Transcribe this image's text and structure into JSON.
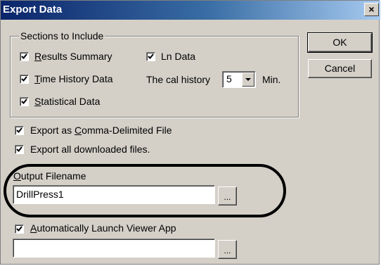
{
  "window": {
    "title": "Export Data",
    "close_glyph": "×"
  },
  "sections_group": {
    "title": "Sections to Include",
    "results_summary": {
      "pre": "",
      "accel": "R",
      "post": "esults Summary",
      "checked": true
    },
    "time_history": {
      "pre": "",
      "accel": "T",
      "post": "ime History Data",
      "checked": true
    },
    "statistical": {
      "pre": "",
      "accel": "S",
      "post": "tatistical Data",
      "checked": true
    },
    "ln_data": {
      "label": "Ln Data",
      "checked": true
    },
    "cal_history": {
      "label": "The cal history",
      "value": "5",
      "unit": "Min."
    }
  },
  "export_csv": {
    "pre": "Export as ",
    "accel": "C",
    "post": "omma-Delimited File",
    "checked": true
  },
  "export_all": {
    "label": "Export all downloaded files.",
    "checked": true
  },
  "output_filename": {
    "label_accel": "O",
    "label_post": "utput Filename",
    "value": "DrillPress1",
    "browse": "..."
  },
  "auto_launch": {
    "pre": "",
    "accel": "A",
    "post": "utomatically Launch Viewer App",
    "checked": true,
    "value": "",
    "browse": "..."
  },
  "buttons": {
    "ok": "OK",
    "cancel": "Cancel"
  },
  "colors": {
    "dialog_bg": "#d4d0c8",
    "title_start": "#0a246a",
    "title_end": "#a6caf0",
    "annotation": "#000000"
  },
  "icons": {
    "checkmark": "checkmark-icon",
    "dropdown": "chevron-down-icon",
    "close": "close-icon"
  }
}
